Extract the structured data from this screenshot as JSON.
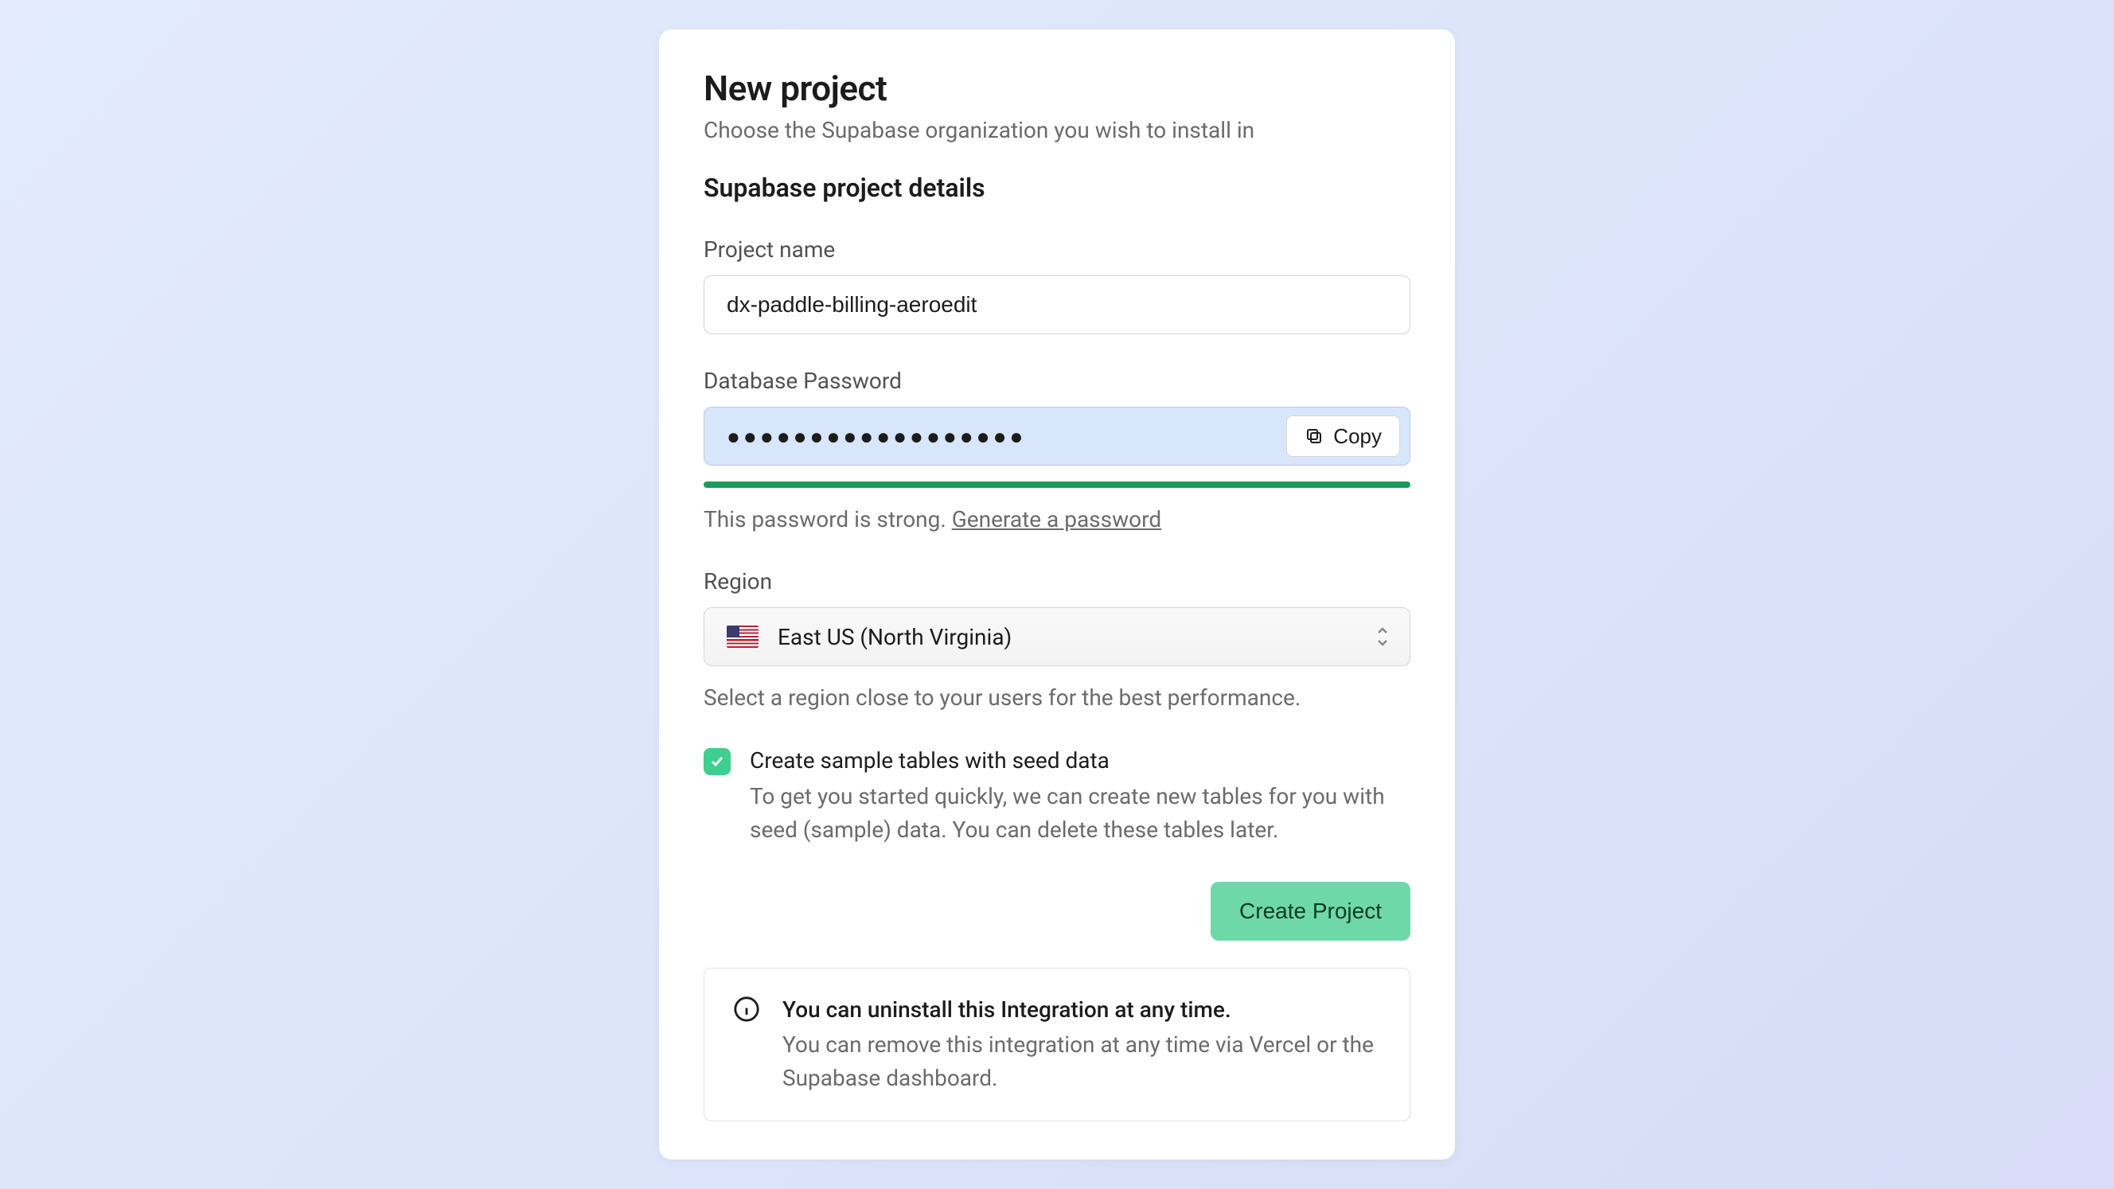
{
  "header": {
    "title": "New project",
    "subtitle": "Choose the Supabase organization you wish to install in"
  },
  "section_title": "Supabase project details",
  "project_name": {
    "label": "Project name",
    "value": "dx-paddle-billing-aeroedit"
  },
  "password": {
    "label": "Database Password",
    "masked_value": "●●●●●●●●●●●●●●●●●●",
    "copy_label": "Copy",
    "strength_text": "This password is strong. ",
    "generate_link": "Generate a password"
  },
  "region": {
    "label": "Region",
    "selected": "East US (North Virginia)",
    "helper": "Select a region close to your users for the best performance."
  },
  "seed": {
    "title": "Create sample tables with seed data",
    "desc": "To get you started quickly, we can create new tables for you with seed (sample) data. You can delete these tables later."
  },
  "create_button": "Create Project",
  "info": {
    "title": "You can uninstall this Integration at any time.",
    "desc": "You can remove this integration at any time via Vercel or the Supabase dashboard."
  }
}
